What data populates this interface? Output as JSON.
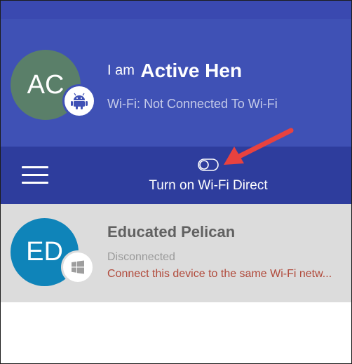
{
  "me": {
    "initials": "AC",
    "prefix": "I am",
    "name": "Active Hen",
    "badge_icon": "android-icon",
    "wifi_status": "Wi-Fi: Not Connected To Wi-Fi"
  },
  "toolbar": {
    "menu_icon": "hamburger-menu-icon",
    "toggle_icon": "toggle-switch-icon",
    "wifi_direct_label": "Turn on Wi-Fi Direct"
  },
  "devices": [
    {
      "initials": "ED",
      "name": "Educated Pelican",
      "status": "Disconnected",
      "warning": "Connect this device to the same Wi-Fi netw...",
      "badge_icon": "windows-icon"
    }
  ],
  "colors": {
    "header": "#3f51b5",
    "toolbar": "#2e3d9d",
    "me_avatar": "#5a7f69",
    "peer_avatar": "#0f84b9",
    "warning_text": "#b14a3b",
    "annotation_arrow": "#e8423f"
  }
}
